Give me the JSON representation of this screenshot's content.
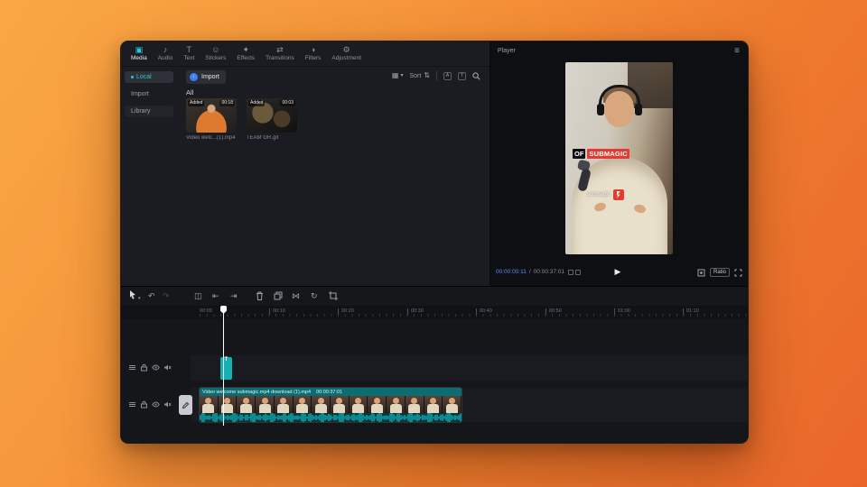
{
  "app": {
    "tabs": [
      {
        "label": "Media",
        "icon": "▣"
      },
      {
        "label": "Audio",
        "icon": "♪"
      },
      {
        "label": "Text",
        "icon": "T"
      },
      {
        "label": "Stickers",
        "icon": "☺"
      },
      {
        "label": "Effects",
        "icon": "✦"
      },
      {
        "label": "Transitions",
        "icon": "⇄"
      },
      {
        "label": "Filters",
        "icon": "◑"
      },
      {
        "label": "Adjustment",
        "icon": "⚙"
      }
    ],
    "sidebar": [
      {
        "label": "Local"
      },
      {
        "label": "Import"
      },
      {
        "label": "Library"
      }
    ],
    "media": {
      "import_button": "Import",
      "section_all": "All",
      "sort_label": "Sort",
      "items": [
        {
          "badge": "Added",
          "duration": "00:18",
          "name": "Video welc...(1).mp4"
        },
        {
          "badge": "Added",
          "duration": "00:03",
          "name": "TEAM GR.gif"
        }
      ]
    },
    "player": {
      "title": "Player",
      "overlay_of": "OF",
      "overlay_brand": "SUBMAGIC",
      "caption_brand": "submagic",
      "current_time": "00:00:00:11",
      "separator": "/",
      "duration": "00:00:37:01",
      "ratio": "Ratio"
    },
    "timeline": {
      "ruler": [
        "00:00",
        "00:10",
        "00:20",
        "00:30",
        "00:40",
        "00:50",
        "01:00",
        "01:10"
      ],
      "text_clip": {
        "glyph": "T"
      },
      "video_clip": {
        "name": "Video welcome submagic.mp4 download (1).mp4",
        "duration": "00:00:37:01"
      }
    },
    "glyphs": {
      "chevron": "▾",
      "grid": "▦",
      "sort": "⇅",
      "menu": "≡",
      "play": "▶",
      "undo": "↶",
      "redo": "↷",
      "split": "◫",
      "trim_left": "⇤",
      "trim_right": "⇥",
      "mirror": "⋈",
      "rotate": "↻",
      "import_arrow": "↓",
      "filter_a": "A",
      "filter_t": "T"
    }
  },
  "colors": {
    "accent_teal": "#2bc7d4",
    "time_blue": "#5d8bff",
    "clip_teal": "#17aeb4",
    "brand_red": "#e63a30",
    "bg_orange_start": "#f9a845",
    "bg_orange_end": "#e9662a"
  }
}
